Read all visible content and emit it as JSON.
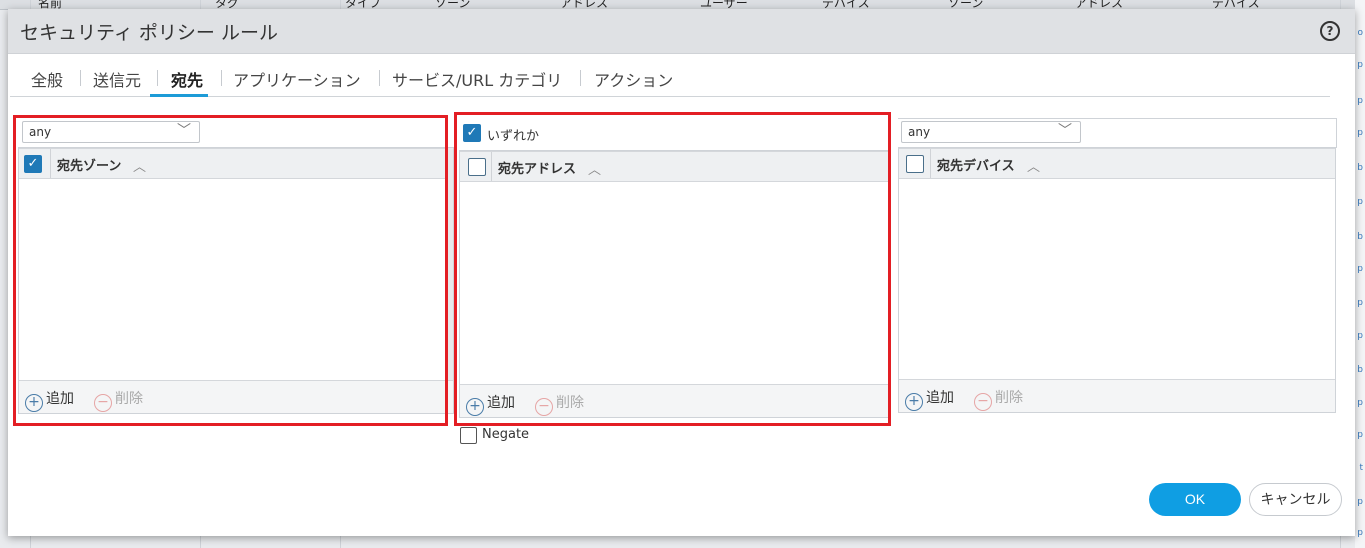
{
  "background": {
    "columns": [
      "名前",
      "タグ",
      "タイプ",
      "ゾーン",
      "アドレス",
      "ユーザー",
      "デバイス",
      "ゾーン",
      "アドレス",
      "デバイス"
    ],
    "right_letters": [
      "o",
      "p",
      "p",
      "p",
      "b",
      "p",
      "b",
      "p",
      "p",
      "p",
      "b",
      "p",
      "p",
      "t",
      "p",
      "p"
    ]
  },
  "dialog": {
    "title": "セキュリティ ポリシー ルール",
    "help": "?"
  },
  "tabs": [
    {
      "label": "全般",
      "active": false
    },
    {
      "label": "送信元",
      "active": false
    },
    {
      "label": "宛先",
      "active": true
    },
    {
      "label": "アプリケーション",
      "active": false
    },
    {
      "label": "サービス/URL カテゴリ",
      "active": false
    },
    {
      "label": "アクション",
      "active": false
    }
  ],
  "zone_panel": {
    "select_value": "any",
    "column_label": "宛先ゾーン",
    "header_checked": true,
    "add_label": "追加",
    "delete_label": "削除"
  },
  "address_panel": {
    "any_label": "いずれか",
    "any_checked": true,
    "column_label": "宛先アドレス",
    "header_checked": false,
    "add_label": "追加",
    "delete_label": "削除",
    "negate_label": "Negate",
    "negate_checked": false
  },
  "device_panel": {
    "select_value": "any",
    "column_label": "宛先デバイス",
    "header_checked": false,
    "add_label": "追加",
    "delete_label": "削除"
  },
  "buttons": {
    "ok": "OK",
    "cancel": "キャンセル"
  },
  "icons": {
    "plus": "+",
    "minus": "−",
    "check": "✓",
    "chevron_up": "︿",
    "chevron_down": "﹀"
  },
  "colors": {
    "accent": "#0f9ee3",
    "checkbox": "#1f79b7",
    "highlight": "#e31e24"
  }
}
